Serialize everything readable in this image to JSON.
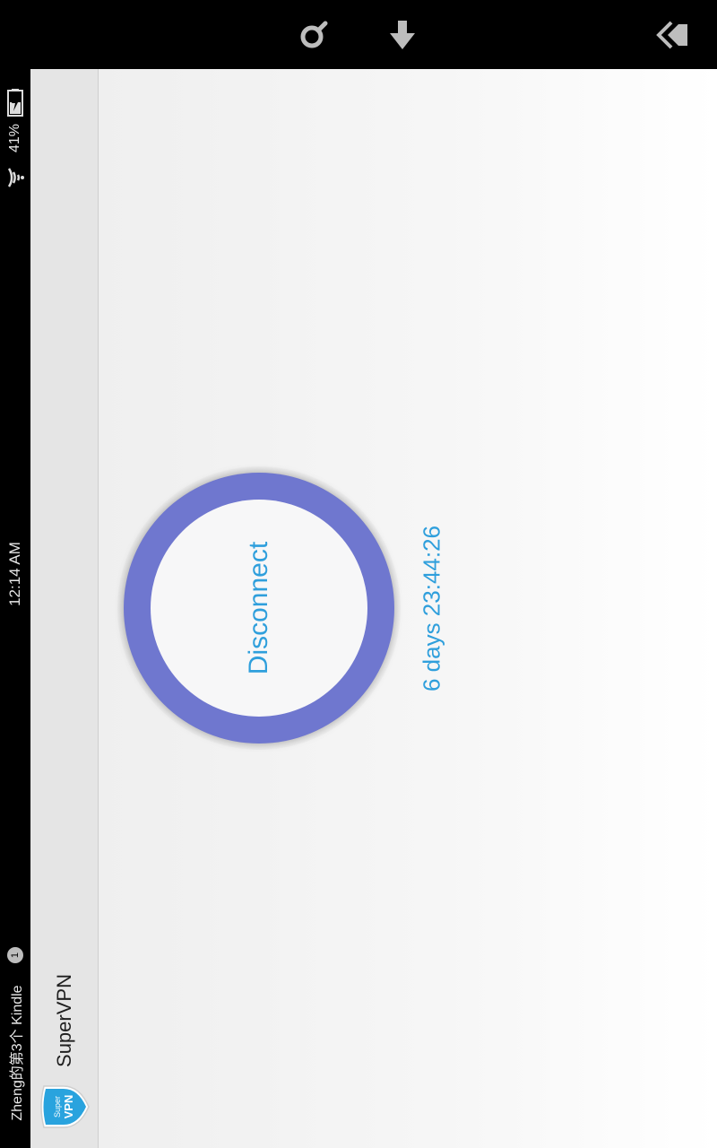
{
  "navbar": {
    "search_icon": "search-icon",
    "download_icon": "download-icon",
    "back_icon": "back-icon"
  },
  "statusbar": {
    "time": "12:14 AM",
    "battery": "41%",
    "device_name": "Zheng的第3个 Kindle",
    "notification_count": "1"
  },
  "app": {
    "title": "SuperVPN",
    "logo_text_top": "Super",
    "logo_text_bottom": "VPN"
  },
  "main": {
    "connect_button_label": "Disconnect",
    "session_timer": "6 days 23:44:26"
  },
  "colors": {
    "ring": "#6f77cf",
    "accent_text": "#2f9fdc",
    "logo_blue": "#29a3de"
  }
}
